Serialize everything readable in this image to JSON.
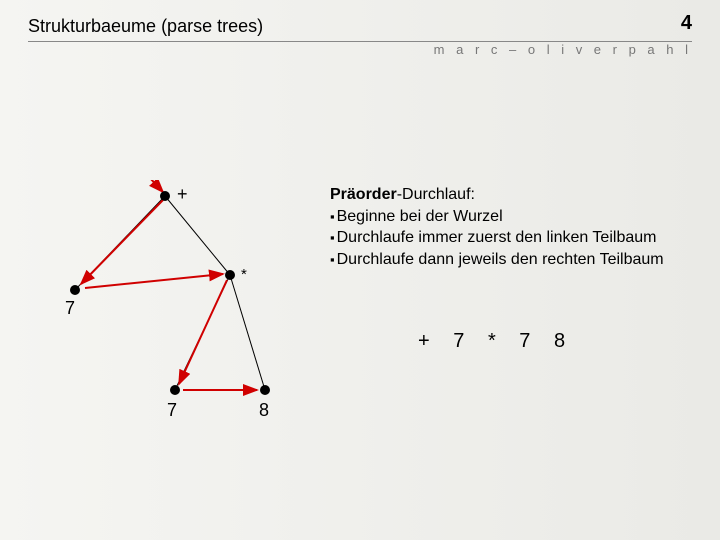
{
  "header": {
    "title": "Strukturbaeume (parse trees)",
    "page_number": "4",
    "author": "m a r c – o l i v e r   p a h l"
  },
  "tree": {
    "root_label": "+",
    "left_label": "7",
    "right_label": "*",
    "right_left_label": "7",
    "right_right_label": "8"
  },
  "explanation": {
    "heading_bold": "Präorder",
    "heading_rest": "-Durchlauf:",
    "bullet1": "Beginne bei der Wurzel",
    "bullet2": "Durchlaufe immer zuerst den linken Teilbaum",
    "bullet3": "Durchlaufe dann jeweils den rechten Teilbaum"
  },
  "result": {
    "t1": "+",
    "t2": "7",
    "t3": "*",
    "t4": "7",
    "t5": "8"
  }
}
